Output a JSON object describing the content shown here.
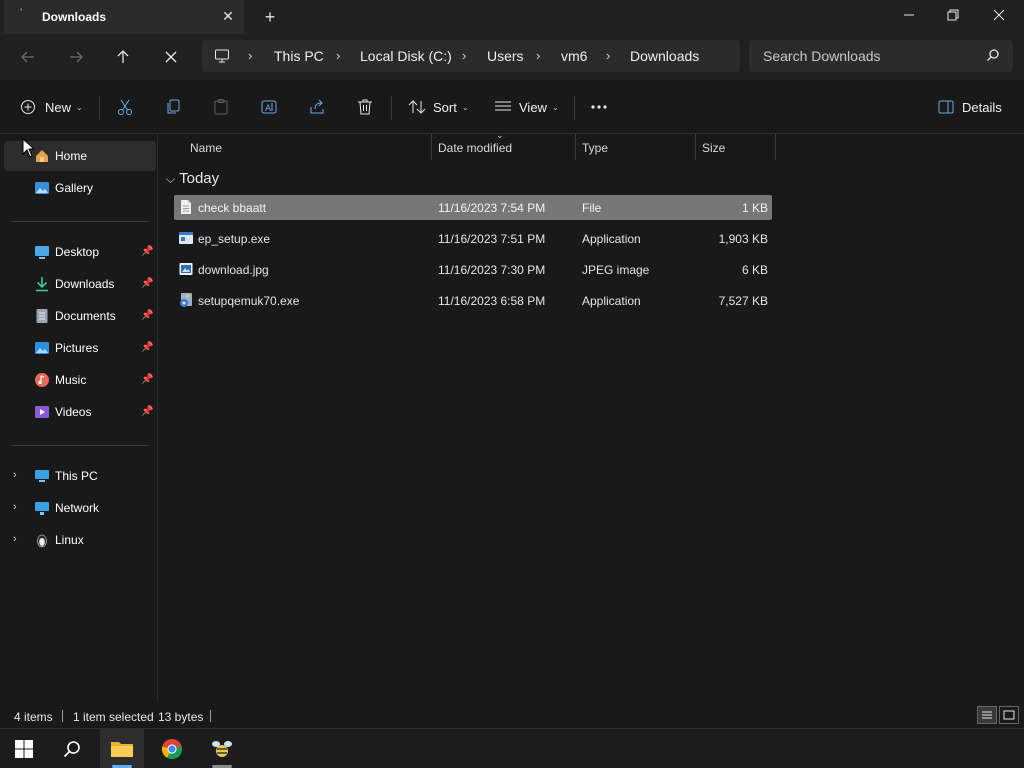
{
  "window": {
    "tab_title": "Downloads",
    "tab_icon": "folder-tab-icon"
  },
  "nav": {
    "breadcrumb": [
      "This PC",
      "Local Disk (C:)",
      "Users",
      "vm6",
      "Downloads"
    ],
    "search_placeholder": "Search Downloads"
  },
  "commands": {
    "new_label": "New",
    "sort_label": "Sort",
    "view_label": "View",
    "details_label": "Details"
  },
  "sidebar": {
    "quick": [
      {
        "label": "Home",
        "icon": "home-icon",
        "selected": true
      },
      {
        "label": "Gallery",
        "icon": "gallery-icon"
      }
    ],
    "pinned": [
      {
        "label": "Desktop",
        "icon": "desktop-icon"
      },
      {
        "label": "Downloads",
        "icon": "downloads-icon"
      },
      {
        "label": "Documents",
        "icon": "documents-icon"
      },
      {
        "label": "Pictures",
        "icon": "pictures-icon"
      },
      {
        "label": "Music",
        "icon": "music-icon"
      },
      {
        "label": "Videos",
        "icon": "videos-icon"
      }
    ],
    "locations": [
      {
        "label": "This PC",
        "icon": "this-pc-icon"
      },
      {
        "label": "Network",
        "icon": "network-icon"
      },
      {
        "label": "Linux",
        "icon": "linux-icon"
      }
    ]
  },
  "file_list": {
    "columns": [
      "Name",
      "Date modified",
      "Type",
      "Size"
    ],
    "group_label": "Today",
    "rows": [
      {
        "name": "check bbaatt",
        "date": "11/16/2023 7:54 PM",
        "type": "File",
        "size": "1 KB",
        "selected": true,
        "icon": "file-icon"
      },
      {
        "name": "ep_setup.exe",
        "date": "11/16/2023 7:51 PM",
        "type": "Application",
        "size": "1,903 KB",
        "icon": "exe-icon"
      },
      {
        "name": "download.jpg",
        "date": "11/16/2023 7:30 PM",
        "type": "JPEG image",
        "size": "6 KB",
        "icon": "image-file-icon"
      },
      {
        "name": "setupqemuk70.exe",
        "date": "11/16/2023 6:58 PM",
        "type": "Application",
        "size": "7,527 KB",
        "icon": "installer-icon"
      }
    ]
  },
  "status": {
    "items_count": "4 items",
    "selection": "1 item selected",
    "size": "13 bytes"
  },
  "colors": {
    "accent": "#5fb2f2",
    "selected_row": "#777777",
    "background": "#191919"
  }
}
